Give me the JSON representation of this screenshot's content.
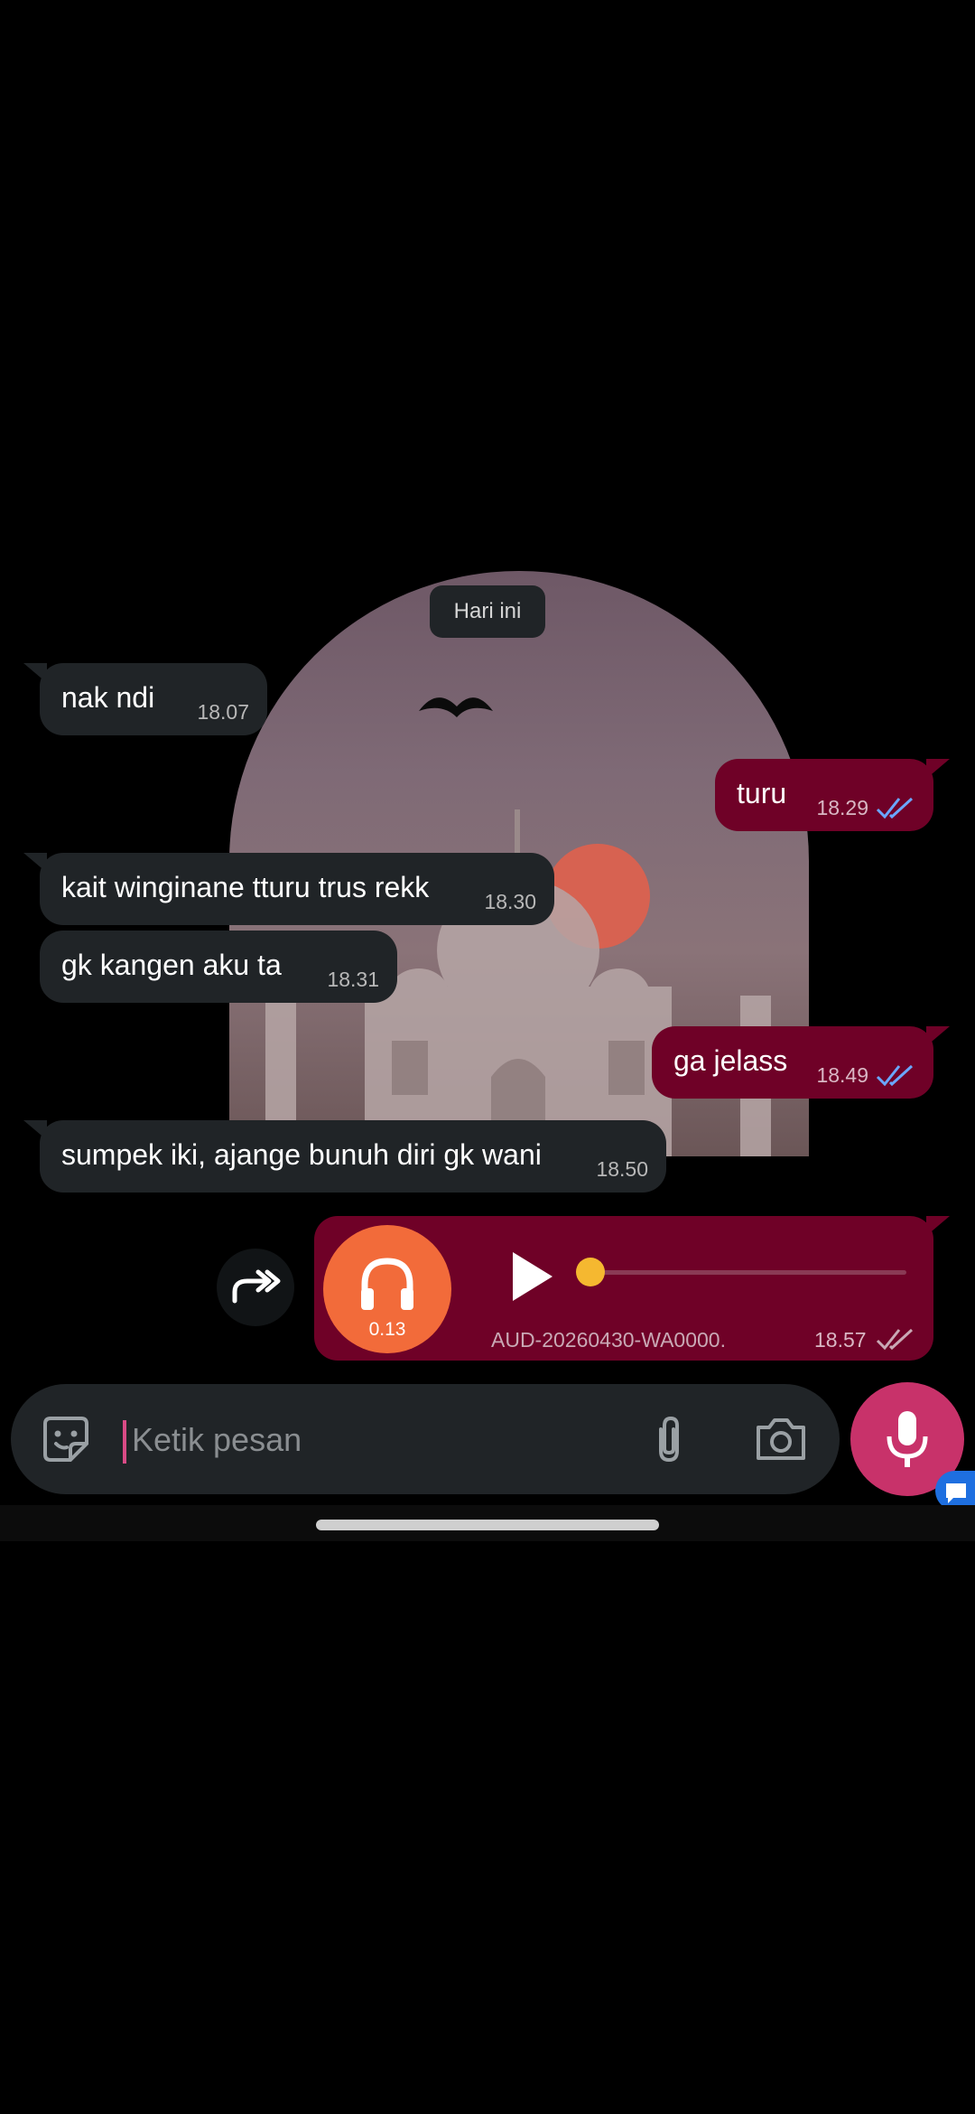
{
  "chat": {
    "date_chip": "Hari ini",
    "messages": [
      {
        "direction": "in",
        "text": "nak ndi",
        "time": "18.07"
      },
      {
        "direction": "out",
        "text": "turu",
        "time": "18.29",
        "status": "read"
      },
      {
        "direction": "in",
        "text": "kait winginane tturu trus rekk",
        "time": "18.30"
      },
      {
        "direction": "in",
        "text": "gk kangen aku ta",
        "time": "18.31"
      },
      {
        "direction": "out",
        "text": "ga jelass",
        "time": "18.49",
        "status": "read"
      },
      {
        "direction": "in",
        "text": "sumpek iki, ajange bunuh diri gk wani",
        "time": "18.50"
      }
    ],
    "voice_note": {
      "direction": "out",
      "duration": "0.13",
      "filename": "AUD-20260430-WA0000.",
      "time": "18.57",
      "status": "delivered",
      "progress": 0
    }
  },
  "composer": {
    "placeholder": "Ketik pesan",
    "icons": [
      "sticker-icon",
      "attach-icon",
      "camera-icon",
      "mic-icon"
    ]
  },
  "colors": {
    "incoming_bubble": "#202427",
    "outgoing_bubble": "#6f0127",
    "read_ticks": "#6aa7ff",
    "mic_button": "#c8326a",
    "voice_avatar": "#f26b3a",
    "progress_knob": "#f5b830"
  }
}
